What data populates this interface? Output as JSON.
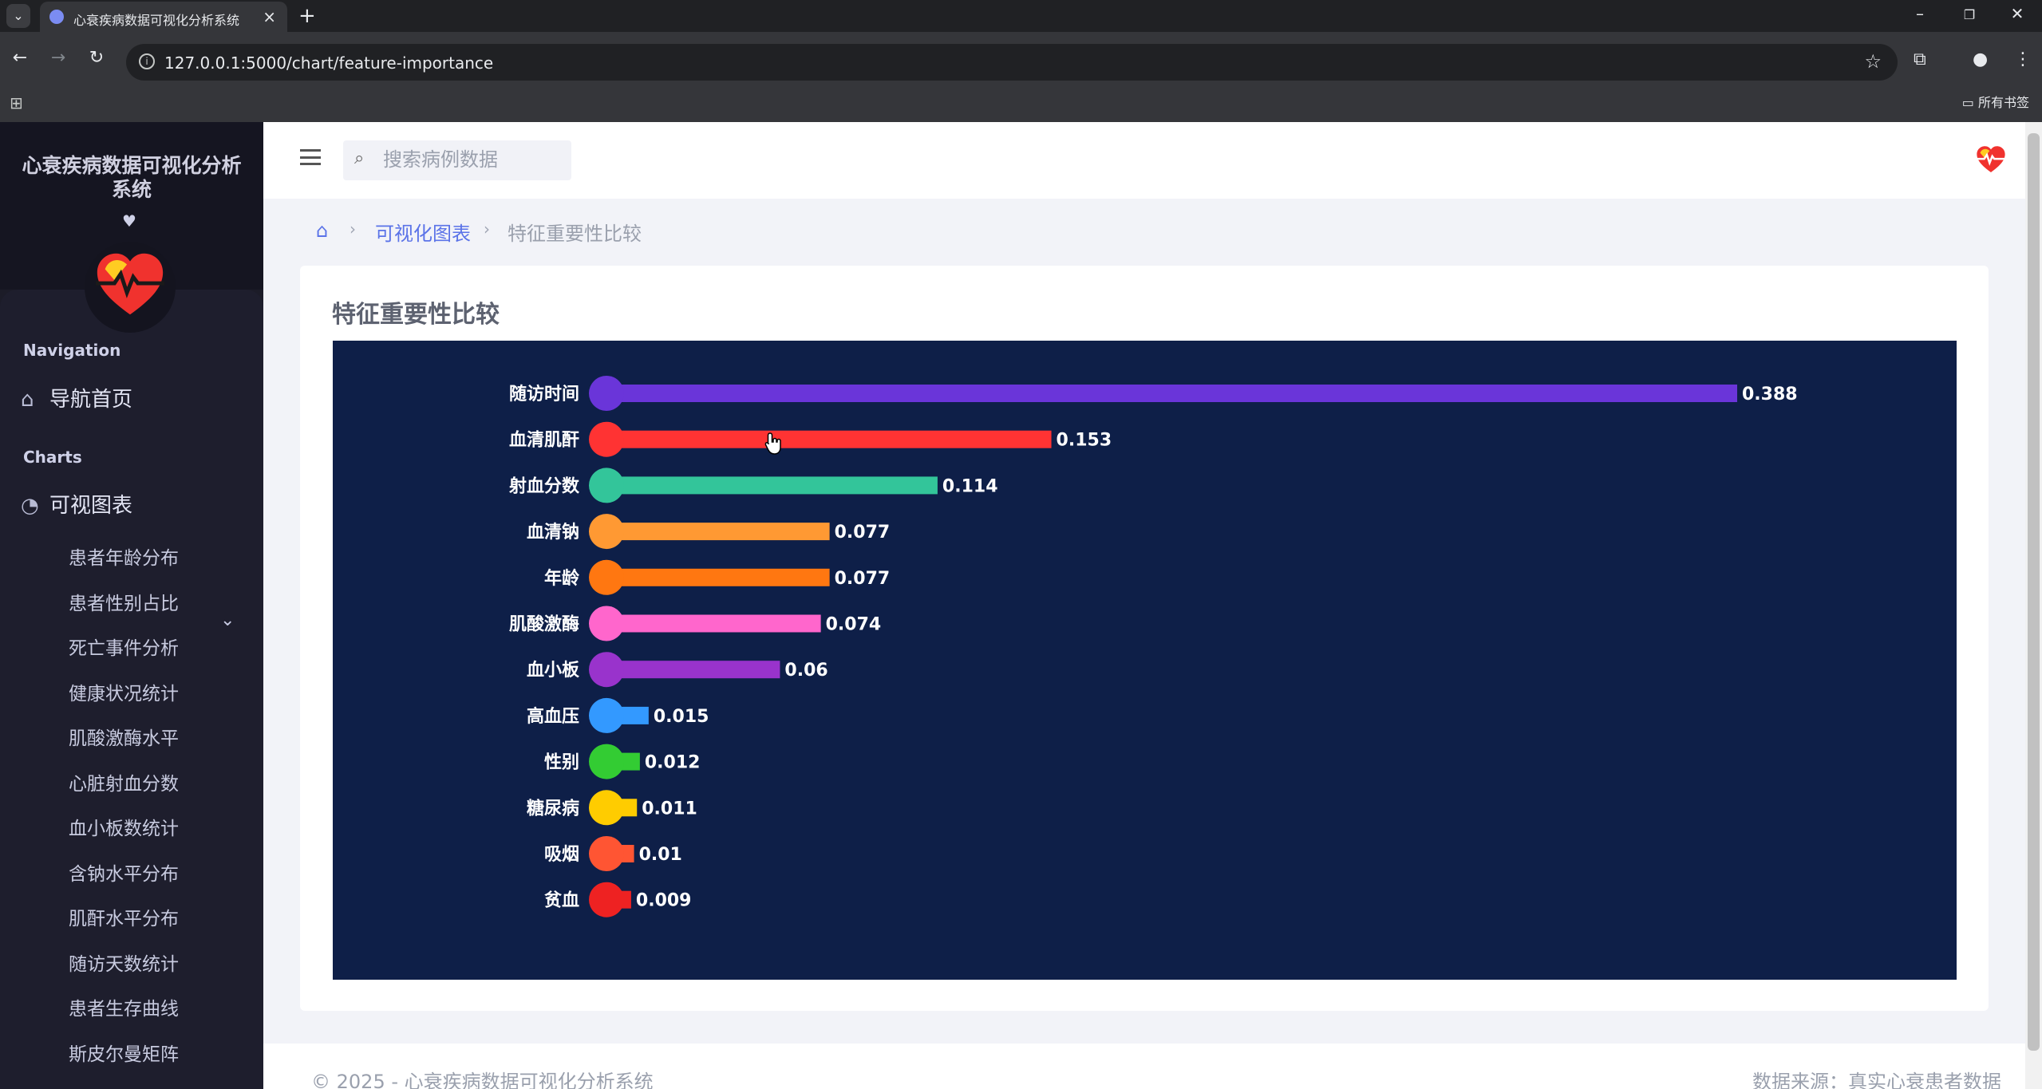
{
  "browser": {
    "tab_title": "心衰疾病数据可视化分析系统",
    "url": "127.0.0.1:5000/chart/feature-importance",
    "bookmarks_label": "所有书签"
  },
  "sidebar": {
    "brand": "心衰疾病数据可视化分析系统",
    "brand_heart": "♥",
    "section_navigation": "Navigation",
    "home_label": "导航首页",
    "section_charts": "Charts",
    "charts_label": "可视图表",
    "sub_items": [
      "患者年龄分布",
      "患者性别占比",
      "死亡事件分析",
      "健康状况统计",
      "肌酸激酶水平",
      "心脏射血分数",
      "血小板数统计",
      "含钠水平分布",
      "肌酐水平分布",
      "随访天数统计",
      "患者生存曲线",
      "斯皮尔曼矩阵"
    ]
  },
  "header": {
    "search_placeholder": "搜索病例数据"
  },
  "breadcrumb": {
    "link": "可视化图表",
    "current": "特征重要性比较"
  },
  "card": {
    "title": "特征重要性比较"
  },
  "chart_data": {
    "type": "bar",
    "orientation": "horizontal",
    "categories": [
      "随访时间",
      "血清肌酐",
      "射血分数",
      "血清钠",
      "年龄",
      "肌酸激酶",
      "血小板",
      "高血压",
      "性别",
      "糖尿病",
      "吸烟",
      "贫血"
    ],
    "values": [
      0.388,
      0.153,
      0.114,
      0.077,
      0.077,
      0.074,
      0.06,
      0.015,
      0.012,
      0.011,
      0.01,
      0.009
    ],
    "colors": [
      "#6a35d9",
      "#ff3333",
      "#33c59a",
      "#ff9933",
      "#ff7711",
      "#ff66cc",
      "#9933cc",
      "#3399ff",
      "#33cc33",
      "#ffcc00",
      "#ff5533",
      "#ee2222"
    ],
    "background": "#0e1f48",
    "title": "",
    "xlabel": "",
    "ylabel": "",
    "xlim": [
      0,
      0.388
    ],
    "grid": false
  },
  "footer": {
    "copyright": "© 2025 - 心衰疾病数据可视化分析系统",
    "source": "数据来源：真实心衰患者数据"
  }
}
